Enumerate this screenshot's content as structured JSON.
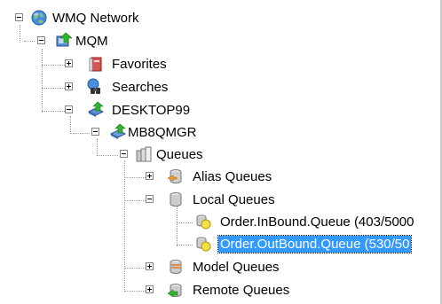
{
  "tree": {
    "items": [
      {
        "label": "WMQ Network",
        "icon": "globe-network-icon",
        "expander": "minus"
      },
      {
        "label": "MQM",
        "icon": "queue-manager-group-icon",
        "expander": "minus"
      },
      {
        "label": "Favorites",
        "icon": "favorites-book-icon",
        "expander": "plus"
      },
      {
        "label": "Searches",
        "icon": "binoculars-search-icon",
        "expander": "plus"
      },
      {
        "label": "DESKTOP99",
        "icon": "server-green-arrow-icon",
        "expander": "minus"
      },
      {
        "label": "MB8QMGR",
        "icon": "queue-manager-icon",
        "expander": "minus"
      },
      {
        "label": "Queues",
        "icon": "queues-folder-icon",
        "expander": "minus"
      },
      {
        "label": "Alias Queues",
        "icon": "alias-queue-icon",
        "expander": "plus"
      },
      {
        "label": "Local Queues",
        "icon": "local-queue-icon",
        "expander": "minus"
      },
      {
        "label": "Order.InBound.Queue (403/5000",
        "icon": "queue-yellow-icon",
        "expander": "none"
      },
      {
        "label": "Order.OutBound.Queue (530/50",
        "icon": "queue-yellow-icon",
        "expander": "none",
        "selected": true
      },
      {
        "label": "Model Queues",
        "icon": "model-queue-icon",
        "expander": "plus"
      },
      {
        "label": "Remote Queues",
        "icon": "remote-queue-icon",
        "expander": "plus"
      }
    ]
  },
  "colors": {
    "selection": "#3399ff",
    "connector": "#a0a0a0",
    "accent_green": "#2db52d"
  }
}
